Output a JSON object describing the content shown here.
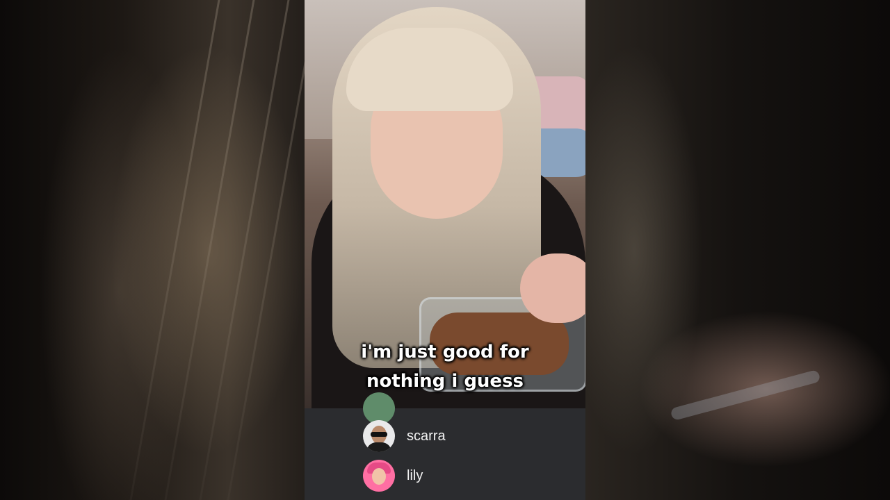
{
  "caption": {
    "line1": "i'm just good for",
    "line2": "nothing i guess"
  },
  "members": [
    {
      "name": "scarra",
      "avatar": "scarra-avatar"
    },
    {
      "name": "lily",
      "avatar": "lily-avatar"
    }
  ],
  "colors": {
    "panel_bg": "#2b2c2f",
    "caption_text": "#ffffff",
    "member_text": "#f1f1f1"
  }
}
